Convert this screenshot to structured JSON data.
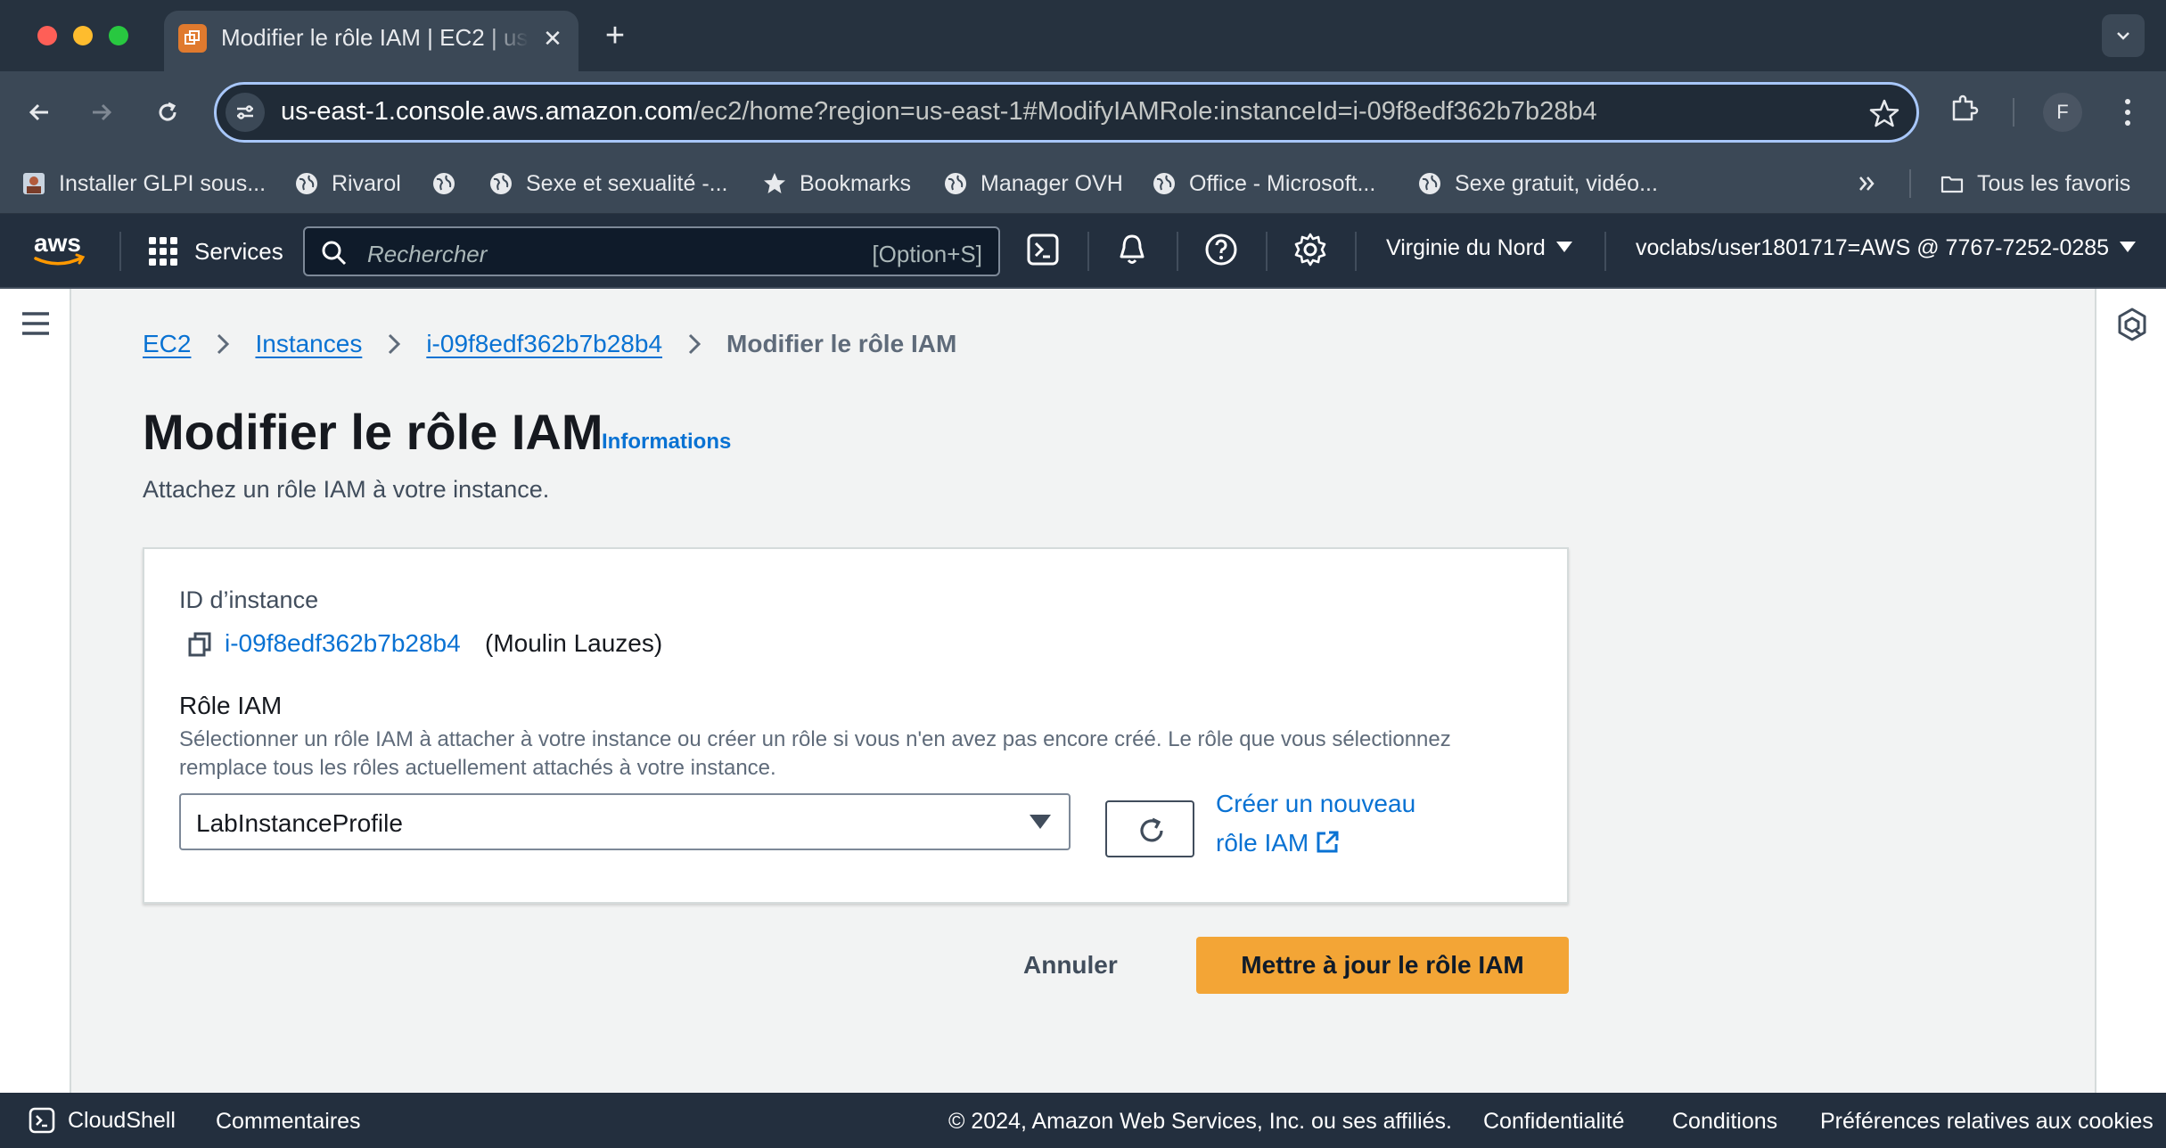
{
  "browser": {
    "tab_title": "Modifier le rôle IAM | EC2 | us-east-1",
    "url_host": "us-east-1.console.aws.amazon.com",
    "url_path": "/ec2/home?region=us-east-1#ModifyIAMRole:instanceId=i-09f8edf362b7b28b4",
    "profile_initial": "F",
    "bookmarks": [
      "Installer GLPI sous...",
      "Rivarol",
      "",
      "Sexe et sexualité -...",
      "Bookmarks",
      "Manager OVH",
      "Office - Microsoft...",
      "Sexe gratuit, vidéo..."
    ],
    "all_bookmarks": "Tous les favoris"
  },
  "aws_nav": {
    "logo": "aws",
    "services": "Services",
    "search_placeholder": "Rechercher",
    "search_shortcut": "[Option+S]",
    "region": "Virginie du Nord",
    "account": "voclabs/user1801717=AWS @ 7767-7252-0285"
  },
  "breadcrumb": {
    "items": [
      "EC2",
      "Instances",
      "i-09f8edf362b7b28b4"
    ],
    "current": "Modifier le rôle IAM"
  },
  "page": {
    "title": "Modifier le rôle IAM",
    "info_link": "Informations",
    "description": "Attachez un rôle IAM à votre instance."
  },
  "form": {
    "instance_label": "ID d’instance",
    "instance_id": "i-09f8edf362b7b28b4",
    "instance_name": "(Moulin Lauzes)",
    "role_label": "Rôle IAM",
    "role_description": "Sélectionner un rôle IAM à attacher à votre instance ou créer un rôle si vous n'en avez pas encore créé. Le rôle que vous sélectionnez remplace tous les rôles actuellement attachés à votre instance.",
    "role_selected": "LabInstanceProfile",
    "create_role_line1": "Créer un nouveau",
    "create_role_line2": "rôle IAM"
  },
  "actions": {
    "cancel": "Annuler",
    "submit": "Mettre à jour le rôle IAM"
  },
  "footer": {
    "cloudshell": "CloudShell",
    "feedback": "Commentaires",
    "copyright": "© 2024, Amazon Web Services, Inc. ou ses affiliés.",
    "privacy": "Confidentialité",
    "terms": "Conditions",
    "cookies": "Préférences relatives aux cookies"
  },
  "colors": {
    "link": "#0972d3",
    "primary_button": "#f3a536",
    "aws_nav_bg": "#232f3e"
  }
}
